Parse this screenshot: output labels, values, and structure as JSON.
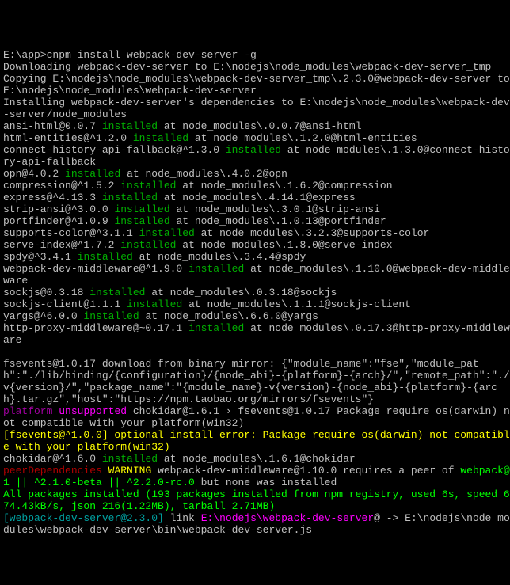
{
  "prompt": {
    "path": "E:\\app>",
    "cmd": "cnpm install webpack-dev-server -g"
  },
  "dl1": "Downloading webpack-dev-server to E:\\nodejs\\node_modules\\webpack-dev-server_tmp",
  "dl2": "Copying E:\\nodejs\\node_modules\\webpack-dev-server_tmp\\.2.3.0@webpack-dev-server to E:\\nodejs\\node_modules\\webpack-dev-server",
  "dl3": "Installing webpack-dev-server's dependencies to E:\\nodejs\\node_modules\\webpack-dev-server/node_modules",
  "installed": [
    {
      "pkg": "ansi-html@0.0.7",
      "at": "at node_modules\\.0.0.7@ansi-html"
    },
    {
      "pkg": "html-entities@^1.2.0",
      "at": "at node_modules\\.1.2.0@html-entities"
    },
    {
      "pkg": "connect-history-api-fallback@^1.3.0",
      "at": "at node_modules\\.1.3.0@connect-history-api-fallback"
    },
    {
      "pkg": "opn@4.0.2",
      "at": "at node_modules\\.4.0.2@opn"
    },
    {
      "pkg": "compression@^1.5.2",
      "at": "at node_modules\\.1.6.2@compression"
    },
    {
      "pkg": "express@^4.13.3",
      "at": "at node_modules\\.4.14.1@express"
    },
    {
      "pkg": "strip-ansi@^3.0.0",
      "at": "at node_modules\\.3.0.1@strip-ansi"
    },
    {
      "pkg": "portfinder@^1.0.9",
      "at": "at node_modules\\.1.0.13@portfinder"
    },
    {
      "pkg": "supports-color@^3.1.1",
      "at": "at node_modules\\.3.2.3@supports-color"
    },
    {
      "pkg": "serve-index@^1.7.2",
      "at": "at node_modules\\.1.8.0@serve-index"
    },
    {
      "pkg": "spdy@^3.4.1",
      "at": "at node_modules\\.3.4.4@spdy"
    },
    {
      "pkg": "webpack-dev-middleware@^1.9.0",
      "at": "at node_modules\\.1.10.0@webpack-dev-middleware"
    },
    {
      "pkg": "sockjs@0.3.18",
      "at": "at node_modules\\.0.3.18@sockjs"
    },
    {
      "pkg": "sockjs-client@1.1.1",
      "at": "at node_modules\\.1.1.1@sockjs-client"
    },
    {
      "pkg": "yargs@^6.0.0",
      "at": "at node_modules\\.6.6.0@yargs"
    },
    {
      "pkg": "http-proxy-middleware@~0.17.1",
      "at": "at node_modules\\.0.17.3@http-proxy-middleware"
    }
  ],
  "fsevents": {
    "pkg": "fsevents@1.0.17",
    "msg": " download from binary mirror: {\"module_name\":\"fse\",\"module_path\":\"./lib/binding/{configuration}/{node_abi}-{platform}-{arch}/\",\"remote_path\":\"./v{version}/\",\"package_name\":\"{module_name}-v{version}-{node_abi}-{platform}-{arch}.tar.gz\",\"host\":\"https://npm.taobao.org/mirrors/fsevents\"}"
  },
  "platform": {
    "line1a": "platform",
    "line1b": "unsupported",
    "line1c": "chokidar@1.6.1 › fsevents@1.0.17 Package require os(darwin) not compatible with your platform(win32)"
  },
  "optional": "[fsevents@^1.0.0] optional install error: Package require os(darwin) not compatible with your platform(win32)",
  "chokidar": {
    "pkg": "chokidar@^1.6.0",
    "at": "at node_modules\\.1.6.1@chokidar"
  },
  "peer": {
    "pd": "peerDependencies",
    "warn": "WARNING",
    "msg": "webpack-dev-middleware@1.10.0 requires a peer of",
    "wp": "webpack@1 || ^2.1.0-beta || ^2.2.0-rc.0",
    "none": "but none was installed"
  },
  "summary": "All packages installed (193 packages installed from npm registry, used 6s, speed 674.43kB/s, json 216(1.22MB), tarball 2.71MB)",
  "link": {
    "pkg": "[webpack-dev-server@2.3.0]",
    "word": "link",
    "src": "E:\\nodejs\\webpack-dev-server",
    "arrow": "@ -> ",
    "dst": "E:\\nodejs\\node_modules\\webpack-dev-server\\bin\\webpack-dev-server.js"
  },
  "kw_installed": "installed"
}
